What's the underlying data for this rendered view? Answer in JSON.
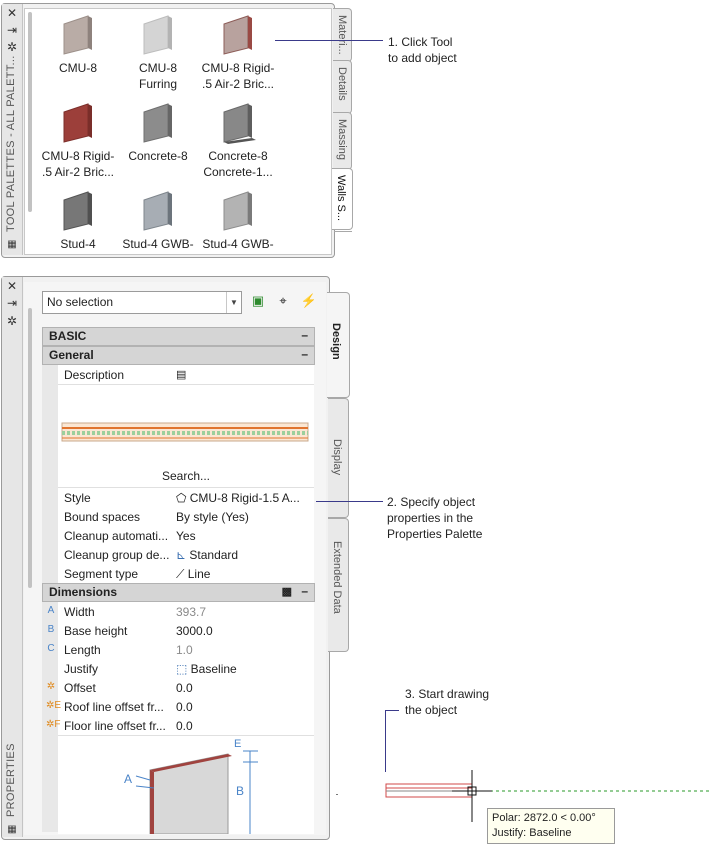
{
  "tool_palette": {
    "title": "TOOL PALETTES - ALL PALETT...",
    "tabs": [
      "Materi...",
      "Details",
      "Massing",
      "Walls S..."
    ],
    "tools": [
      {
        "label_1": "CMU-8",
        "label_2": "",
        "icon": "wall-tool-icon"
      },
      {
        "label_1": "CMU-8",
        "label_2": "Furring",
        "icon": "wall-tool-icon"
      },
      {
        "label_1": "CMU-8 Rigid-",
        "label_2": ".5 Air-2 Bric...",
        "icon": "wall-tool-icon"
      },
      {
        "label_1": "CMU-8 Rigid-",
        "label_2": ".5 Air-2 Bric...",
        "icon": "wall-tool-icon"
      },
      {
        "label_1": "Concrete-8",
        "label_2": "",
        "icon": "wall-tool-icon"
      },
      {
        "label_1": "Concrete-8",
        "label_2": "Concrete-1...",
        "icon": "wall-tool-icon"
      },
      {
        "label_1": "Stud-4",
        "label_2": "",
        "icon": "wall-tool-icon"
      },
      {
        "label_1": "Stud-4 GWB-",
        "label_2": "",
        "icon": "wall-tool-icon"
      },
      {
        "label_1": "Stud-4 GWB-",
        "label_2": "",
        "icon": "wall-tool-icon"
      }
    ]
  },
  "properties": {
    "title": "PROPERTIES",
    "selection": "No selection",
    "tabs": [
      "Design",
      "Display",
      "Extended Data"
    ],
    "sections": {
      "basic": "BASIC",
      "general": "General",
      "dimensions": "Dimensions"
    },
    "general_rows": [
      {
        "key": "Description",
        "value": ""
      },
      {
        "key": "Style",
        "value": "CMU-8 Rigid-1.5 A..."
      },
      {
        "key": "Bound spaces",
        "value": "By style (Yes)"
      },
      {
        "key": "Cleanup automati...",
        "value": "Yes"
      },
      {
        "key": "Cleanup group de...",
        "value": "Standard"
      },
      {
        "key": "Segment type",
        "value": "Line"
      }
    ],
    "search_label": "Search...",
    "dimension_rows": [
      {
        "letter": "A",
        "key": "Width",
        "value": "393.7",
        "dim": true
      },
      {
        "letter": "B",
        "key": "Base height",
        "value": "3000.0",
        "dim": false
      },
      {
        "letter": "C",
        "key": "Length",
        "value": "1.0",
        "dim": true
      },
      {
        "letter": "",
        "key": "Justify",
        "value": "Baseline",
        "dim": false
      },
      {
        "letter": "✲",
        "key": "Offset",
        "value": "0.0",
        "dim": false
      },
      {
        "letter": "✲E",
        "key": "Roof line offset fr...",
        "value": "0.0",
        "dim": false
      },
      {
        "letter": "✲F",
        "key": "Floor line offset fr...",
        "value": "0.0",
        "dim": false
      }
    ],
    "diagram_labels": {
      "a": "A",
      "b": "B",
      "e": "E"
    }
  },
  "annotations": {
    "step1_l1": "1. Click Tool",
    "step1_l2": "to add object",
    "step2_l1": "2. Specify object",
    "step2_l2": "properties in the",
    "step2_l3": "Properties Palette",
    "step3_l1": "3. Start drawing",
    "step3_l2": "the object"
  },
  "tooltip": {
    "polar": "Polar: 2872.0 < 0.00°",
    "justify": "Justify: Baseline"
  },
  "colors": {
    "wall_red": "#a0433f",
    "accent_blue": "#3a3a8a",
    "tracking_green": "#2a9a2a"
  }
}
